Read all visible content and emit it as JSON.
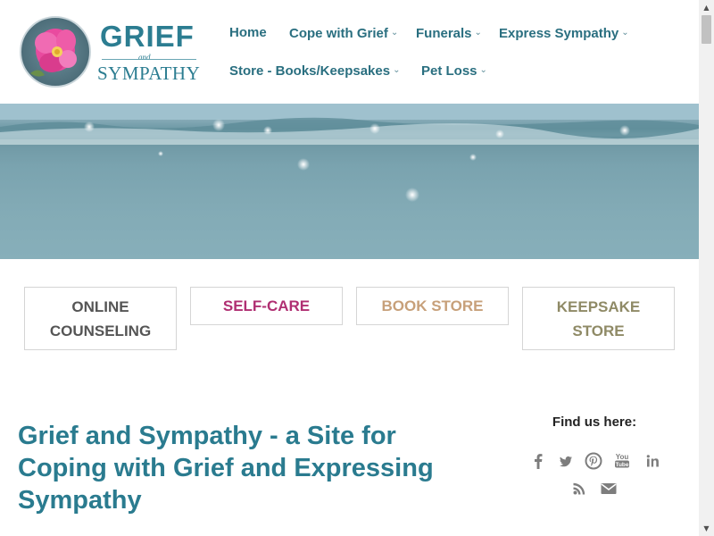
{
  "logo": {
    "title": "GRIEF",
    "and": "and",
    "subtitle": "SYMPATHY"
  },
  "nav": {
    "items": [
      {
        "label": "Home",
        "dropdown": false
      },
      {
        "label": "Cope with Grief",
        "dropdown": true
      },
      {
        "label": "Funerals",
        "dropdown": true
      },
      {
        "label": "Express Sympathy",
        "dropdown": true
      },
      {
        "label": "Store - Books/Keepsakes",
        "dropdown": true
      },
      {
        "label": "Pet Loss",
        "dropdown": true
      }
    ]
  },
  "cta": {
    "online_counseling": {
      "line1": "ONLINE",
      "line2": "COUNSELING",
      "color": "#555555"
    },
    "self_care": {
      "label": "SELF-CARE",
      "color": "#b02f72"
    },
    "book_store": {
      "label": "BOOK STORE",
      "color": "#c7a07a"
    },
    "keepsake_store": {
      "line1": "KEEPSAKE",
      "line2": "STORE",
      "color": "#8f8a66"
    }
  },
  "main": {
    "title_line1": "Grief and Sympathy - a Site for",
    "title_line2": "Coping with Grief and Expressing",
    "title_line3": "Sympathy"
  },
  "sidebar": {
    "find_us": "Find us here:",
    "social_icons": [
      "facebook-icon",
      "twitter-icon",
      "pinterest-icon",
      "youtube-icon",
      "linkedin-icon",
      "rss-icon",
      "email-icon"
    ]
  },
  "colors": {
    "brand": "#2c7d91",
    "nav_text": "#2a6f80",
    "social_gray": "#777777"
  }
}
